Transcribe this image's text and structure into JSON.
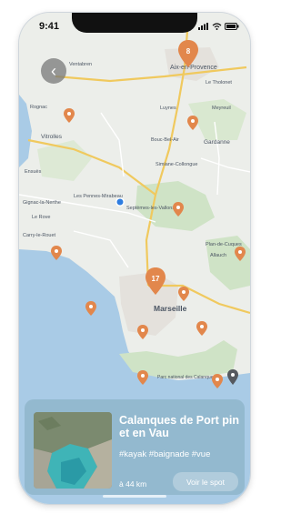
{
  "status_bar": {
    "time": "9:41"
  },
  "map": {
    "labels": {
      "aix": "Aix-en-Provence",
      "marseille": "Marseille",
      "gardanne": "Gardanne",
      "vitrolles": "Vitrolles",
      "les_pennes": "Les Pennes-Mirabeau",
      "septemes": "Septèmes-les-Vallons",
      "plan_cuques": "Plan-de-Cuques",
      "allauch": "Allauch",
      "parc": "Parc national des Calanques",
      "luynes": "Luynes",
      "meyreuil": "Meyreuil",
      "bouc": "Bouc-Bel-Air",
      "simiane": "Simiane-Collongue",
      "ventabren": "Ventabren",
      "rognac": "Rognac",
      "le_tholonet": "Le Tholonet",
      "gignac": "Gignac-la-Nerthe",
      "le_rove": "Le Rove",
      "ensues": "Ensuès",
      "carry": "Carry-le-Rouet"
    },
    "cluster_aix": "8",
    "cluster_marseille": "17"
  },
  "card": {
    "title": "Calanques de Port pin et en Vau",
    "tags": "#kayak #baignade #vue",
    "distance": "à 44 km",
    "cta": "Voir le spot"
  }
}
